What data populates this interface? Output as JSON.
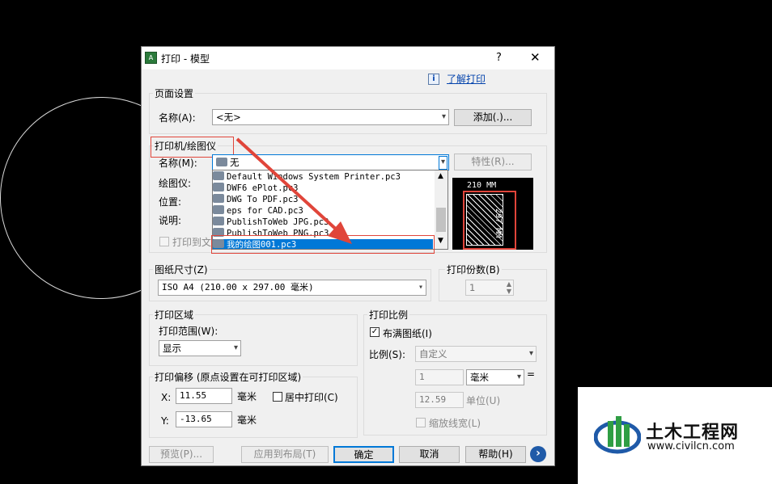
{
  "dialog": {
    "title": "打印 - 模型",
    "help_button": "?",
    "close_button": "✕",
    "learn_link": "了解打印"
  },
  "page_setup": {
    "label": "页面设置",
    "name_label": "名称(A):",
    "name_value": "<无>",
    "add_button": "添加(.)..."
  },
  "printer": {
    "label": "打印机/绘图仪",
    "name_label": "名称(M):",
    "name_value": "无",
    "properties_button": "特性(R)...",
    "plotter_label": "绘图仪:",
    "where_label": "位置:",
    "description_label": "说明:",
    "print_to_file_label": "打印到文件",
    "list_items": [
      "Default Windows System Printer.pc3",
      "DWF6 ePlot.pc3",
      "DWG To PDF.pc3",
      "eps for CAD.pc3",
      "PublishToWeb JPG.pc3",
      "PublishToWeb PNG.pc3",
      "我的绘图001.pc3"
    ],
    "preview_width": "210 MM",
    "preview_height": "297 MM"
  },
  "paper_size": {
    "label": "图纸尺寸(Z)",
    "value": "ISO A4 (210.00 x 297.00 毫米)"
  },
  "copies": {
    "label": "打印份数(B)",
    "value": "1"
  },
  "plot_area": {
    "label": "打印区域",
    "range_label": "打印范围(W):",
    "range_value": "显示"
  },
  "plot_offset": {
    "label": "打印偏移 (原点设置在可打印区域)",
    "x_label": "X:",
    "x_value": "11.55",
    "x_unit": "毫米",
    "y_label": "Y:",
    "y_value": "-13.65",
    "y_unit": "毫米",
    "center_label": "居中打印(C)"
  },
  "plot_scale": {
    "label": "打印比例",
    "fit_label": "布满图纸(I)",
    "scale_label": "比例(S):",
    "scale_value": "自定义",
    "value1": "1",
    "unit1": "毫米",
    "equals": "=",
    "value2": "12.59",
    "unit2": "单位(U)",
    "lineweights_label": "缩放线宽(L)"
  },
  "footer": {
    "preview_button": "预览(P)...",
    "apply_button": "应用到布局(T)",
    "ok_button": "确定",
    "cancel_button": "取消",
    "help_button": "帮助(H)",
    "more_button": "›"
  },
  "watermark": {
    "name": "土木工程网",
    "url": "www.civilcn.com"
  },
  "colors": {
    "highlight": "#0078d7",
    "annotation_red": "#e0453a",
    "link": "#0645ad"
  }
}
